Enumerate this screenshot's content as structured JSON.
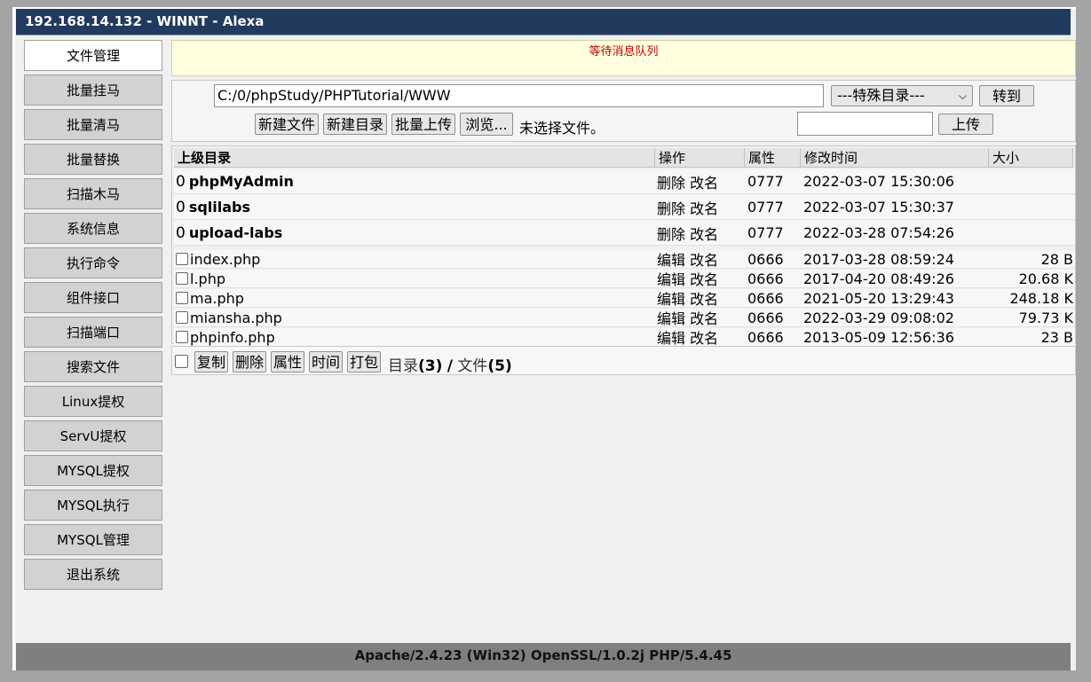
{
  "title": "192.168.14.132 - WINNT - Alexa",
  "sidebar": {
    "items": [
      {
        "label": "文件管理"
      },
      {
        "label": "批量挂马"
      },
      {
        "label": "批量清马"
      },
      {
        "label": "批量替换"
      },
      {
        "label": "扫描木马"
      },
      {
        "label": "系统信息"
      },
      {
        "label": "执行命令"
      },
      {
        "label": "组件接口"
      },
      {
        "label": "扫描端口"
      },
      {
        "label": "搜索文件"
      },
      {
        "label": "Linux提权"
      },
      {
        "label": "ServU提权"
      },
      {
        "label": "MYSQL提权"
      },
      {
        "label": "MYSQL执行"
      },
      {
        "label": "MYSQL管理"
      },
      {
        "label": "退出系统"
      }
    ]
  },
  "message": "等待消息队列",
  "toolbox": {
    "path_value": "C:/0/phpStudy/PHPTutorial/WWW",
    "special_dir": "---特殊目录---",
    "goto_label": "转到",
    "new_file": "新建文件",
    "new_dir": "新建目录",
    "batch_upload": "批量上传",
    "browse": "浏览...",
    "no_file": "未选择文件。",
    "upload_label": "上传"
  },
  "table": {
    "headers": {
      "parent": "上级目录",
      "ops": "操作",
      "attr": "属性",
      "mtime": "修改时间",
      "size": "大小"
    },
    "dirs": [
      {
        "num": "0",
        "name": "phpMyAdmin",
        "op1": "删除",
        "op2": "改名",
        "perm": "0777",
        "time": "2022-03-07 15:30:06"
      },
      {
        "num": "0",
        "name": "sqlilabs",
        "op1": "删除",
        "op2": "改名",
        "perm": "0777",
        "time": "2022-03-07 15:30:37"
      },
      {
        "num": "0",
        "name": "upload-labs",
        "op1": "删除",
        "op2": "改名",
        "perm": "0777",
        "time": "2022-03-28 07:54:26"
      }
    ],
    "files": [
      {
        "name": "index.php",
        "op1": "编辑",
        "op2": "改名",
        "perm": "0666",
        "time": "2017-03-28 08:59:24",
        "size": "28 B"
      },
      {
        "name": "l.php",
        "op1": "编辑",
        "op2": "改名",
        "perm": "0666",
        "time": "2017-04-20 08:49:26",
        "size": "20.68 K"
      },
      {
        "name": "ma.php",
        "op1": "编辑",
        "op2": "改名",
        "perm": "0666",
        "time": "2021-05-20 13:29:43",
        "size": "248.18 K"
      },
      {
        "name": "miansha.php",
        "op1": "编辑",
        "op2": "改名",
        "perm": "0666",
        "time": "2022-03-29 09:08:02",
        "size": "79.73 K"
      },
      {
        "name": "phpinfo.php",
        "op1": "编辑",
        "op2": "改名",
        "perm": "0666",
        "time": "2013-05-09 12:56:36",
        "size": "23 B"
      }
    ]
  },
  "bottom": {
    "copy": "复制",
    "delete": "删除",
    "attr": "属性",
    "time": "时间",
    "pack": "打包",
    "dir_label": "目录",
    "dir_count": "(3)",
    "sep": "/",
    "file_label": "文件",
    "file_count": "(5)"
  },
  "footer": "Apache/2.4.23 (Win32) OpenSSL/1.0.2j PHP/5.4.45"
}
